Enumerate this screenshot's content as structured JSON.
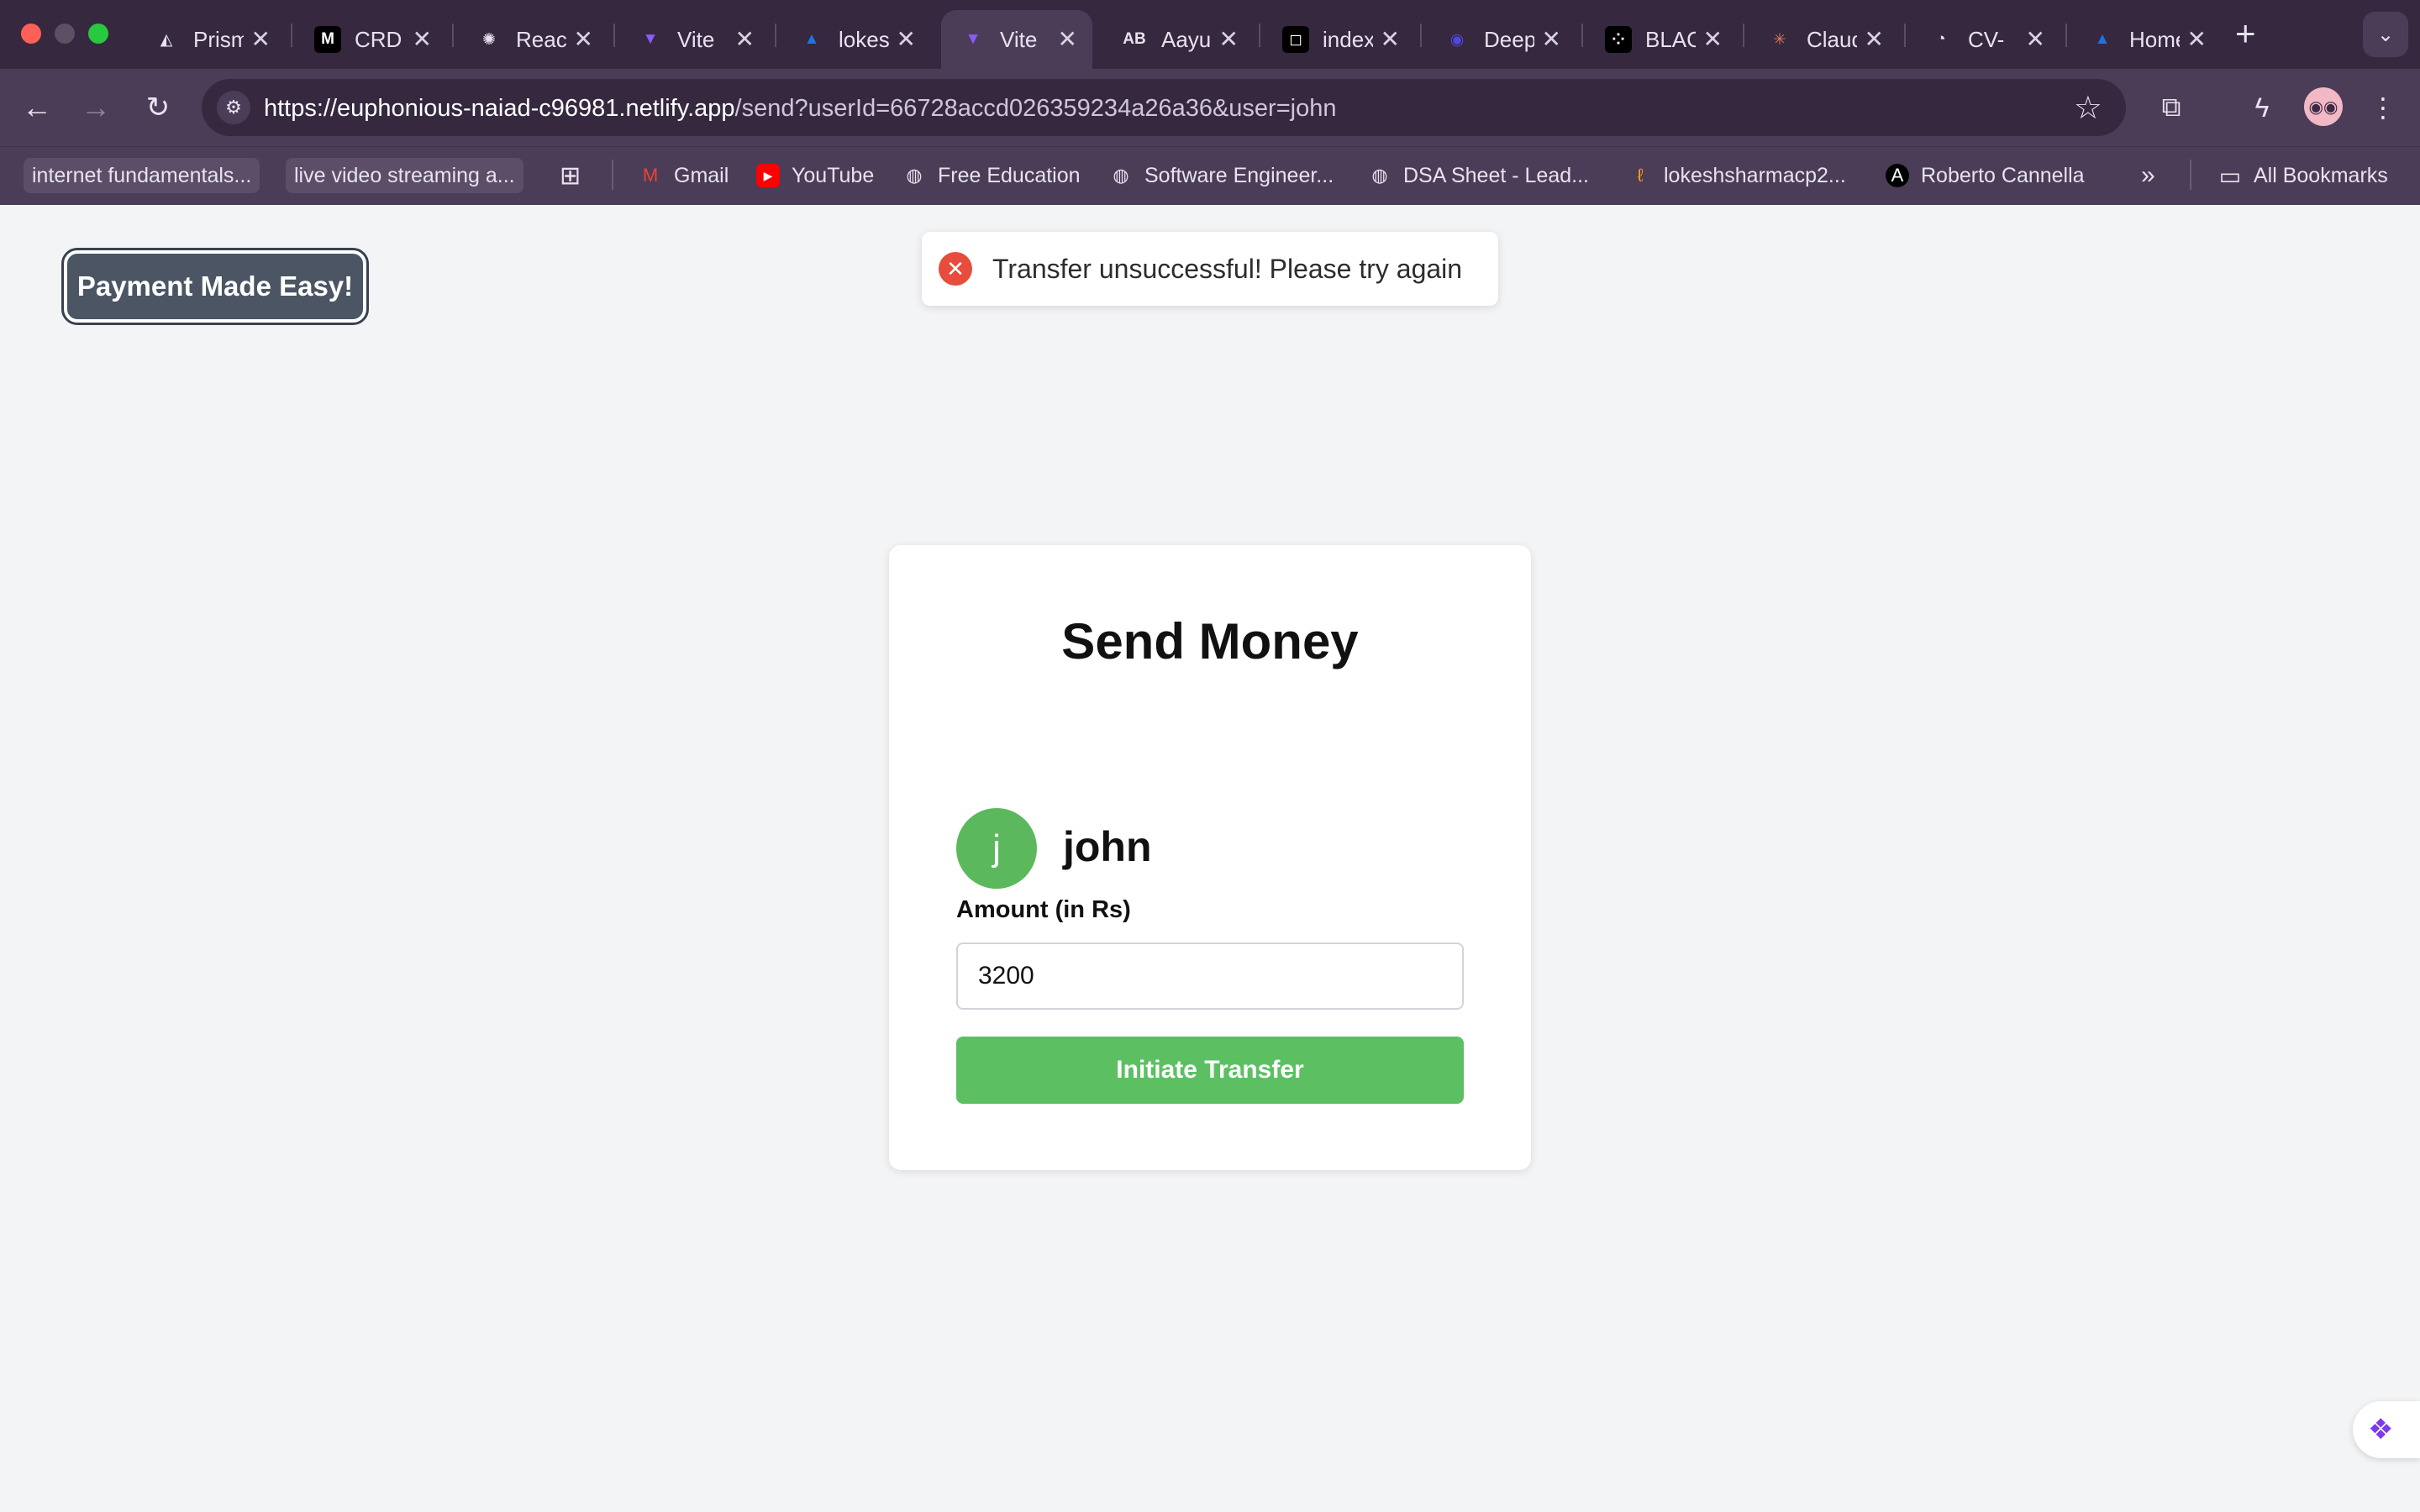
{
  "browser": {
    "tabs": [
      {
        "title": "Prism",
        "icon": "prism-icon",
        "glyph": "◭",
        "color": "#3a2a44"
      },
      {
        "title": "CRD",
        "icon": "medium-icon",
        "glyph": "M",
        "color": "#000000"
      },
      {
        "title": "React",
        "icon": "openai-icon",
        "glyph": "✺",
        "color": "#3a2a44"
      },
      {
        "title": "Vite",
        "icon": "vite-icon",
        "glyph": "▼",
        "color": "#8b5cf6"
      },
      {
        "title": "lokesh",
        "icon": "drive-icon",
        "glyph": "▲",
        "color": "#1a73e8"
      },
      {
        "title": "Vite",
        "icon": "vite-icon",
        "glyph": "▼",
        "color": "#8b5cf6"
      },
      {
        "title": "Aayush",
        "icon": "ab-logo-icon",
        "glyph": "AB",
        "color": "#3a2a44"
      },
      {
        "title": "index",
        "icon": "notion-icon",
        "glyph": "◻",
        "color": "#000000"
      },
      {
        "title": "Deep",
        "icon": "deep-icon",
        "glyph": "◉",
        "color": "#4f46e5"
      },
      {
        "title": "BLACK",
        "icon": "black-icon",
        "glyph": "⁘",
        "color": "#111111"
      },
      {
        "title": "Claude",
        "icon": "claude-icon",
        "glyph": "✳",
        "color": "#d97757"
      },
      {
        "title": "CV-",
        "icon": "cv-icon",
        "glyph": "◔",
        "color": "#3a2a44"
      },
      {
        "title": "Home",
        "icon": "drive-icon",
        "glyph": "▲",
        "color": "#1a73e8"
      }
    ],
    "url_host": "https://euphonious-naiad-c96981.netlify.app",
    "url_path": "/send?userId=66728accd026359234a26a36&user=john",
    "bookmarks": [
      {
        "label": "internet fundamentals..."
      },
      {
        "label": "live video streaming a..."
      },
      {
        "label": "Gmail",
        "icon": "gmail-icon"
      },
      {
        "label": "YouTube",
        "icon": "youtube-icon"
      },
      {
        "label": "Free Education",
        "icon": "globe-icon"
      },
      {
        "label": "Software Engineer...",
        "icon": "globe-icon"
      },
      {
        "label": "DSA Sheet - Lead...",
        "icon": "globe-icon"
      },
      {
        "label": "lokeshsharmacp2...",
        "icon": "leetcode-icon"
      },
      {
        "label": "Roberto Cannella",
        "icon": "a-logo-icon"
      }
    ],
    "all_bookmarks_label": "All Bookmarks"
  },
  "page": {
    "brand_label": "Payment Made Easy!",
    "toast_message": "Transfer unsuccessful! Please try again",
    "card_title": "Send Money",
    "recipient_initial": "j",
    "recipient_name": "john",
    "amount_label": "Amount (in Rs)",
    "amount_value": "3200",
    "submit_label": "Initiate Transfer"
  },
  "colors": {
    "chrome_bg": "#35283f",
    "toolbar_bg": "#4b3d57",
    "page_bg": "#f3f4f6",
    "accent_green": "#5cc063",
    "error_red": "#e74c3c",
    "brand_btn_bg": "#4b5563"
  }
}
